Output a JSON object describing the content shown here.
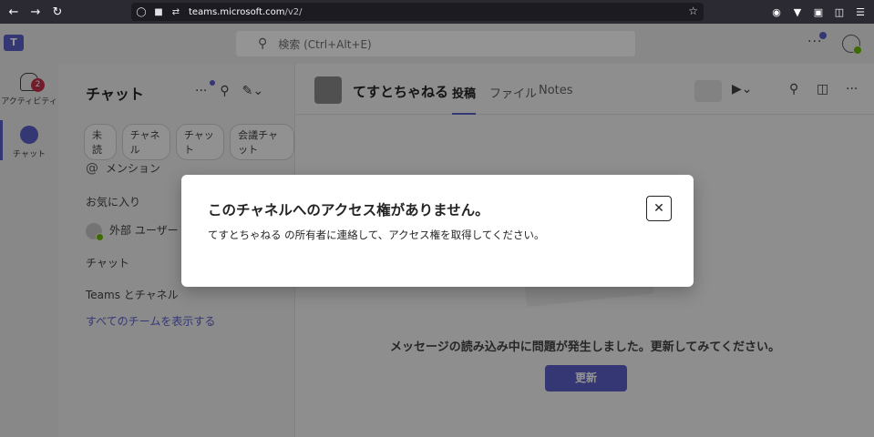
{
  "browser": {
    "url_host": "teams.microsoft.com",
    "url_path": "/v2/"
  },
  "teams": {
    "search_placeholder": "検索 (Ctrl+Alt+E)",
    "rail": [
      {
        "label": "アクティビティ",
        "badge": "2"
      },
      {
        "label": "チャット"
      }
    ],
    "list": {
      "title": "チャット",
      "filters": [
        "未読",
        "チャネル",
        "チャット",
        "会議チャット"
      ],
      "mention": "メンション",
      "favorites": "お気に入り",
      "external_user": "外部 ユーザー (",
      "chat_section": "チャット",
      "teams_section": "Teams とチャネル",
      "show_all": "すべてのチームを表示する"
    },
    "channel": {
      "name": "てすとちゃねる",
      "tabs": [
        "投稿",
        "ファイル",
        "Notes"
      ],
      "error_message": "メッセージの読み込み中に問題が発生しました。更新してみてください。",
      "refresh_label": "更新"
    }
  },
  "dialog": {
    "title": "このチャネルへのアクセス権がありません。",
    "body": "てすとちゃねる の所有者に連絡して、アクセス権を取得してください。",
    "close_icon": "close-icon"
  },
  "colors": {
    "accent": "#5b5fc7",
    "badge": "#c4314b",
    "browser_chrome": "#2b2a33"
  }
}
